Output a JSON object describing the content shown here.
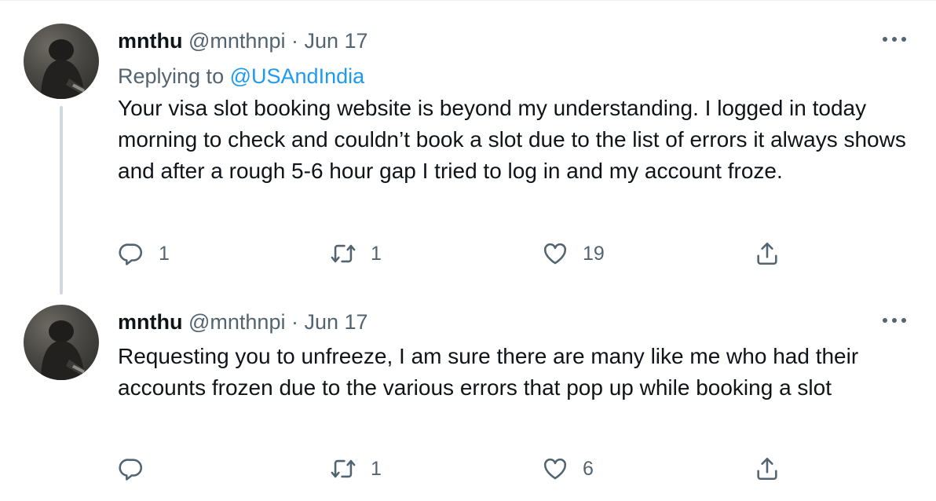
{
  "tweets": [
    {
      "name": "mnthu",
      "handle": "@mnthnpi",
      "separator": "·",
      "date": "Jun 17",
      "replying_prefix": "Replying to",
      "replying_to": "@USAndIndia",
      "text": "Your visa slot booking website is beyond my understanding. I logged in today morning to check and couldn’t book a slot due to the list of errors it always shows and after a rough 5-6 hour gap I tried to log in and my account froze.",
      "reply_count": "1",
      "retweet_count": "1",
      "like_count": "19"
    },
    {
      "name": "mnthu",
      "handle": "@mnthnpi",
      "separator": "·",
      "date": "Jun 17",
      "text": "Requesting you to unfreeze, I am sure there are many like me who had their accounts frozen due to the various errors that pop up while booking a slot",
      "reply_count": "",
      "retweet_count": "1",
      "like_count": "6"
    }
  ],
  "icons": {
    "more": "more-horizontal-icon",
    "reply": "reply-icon",
    "retweet": "retweet-icon",
    "like": "heart-icon",
    "share": "share-icon"
  },
  "colors": {
    "text": "#0f1419",
    "secondary": "#536471",
    "link": "#1d9bf0",
    "thread_line": "#cfd9de"
  }
}
